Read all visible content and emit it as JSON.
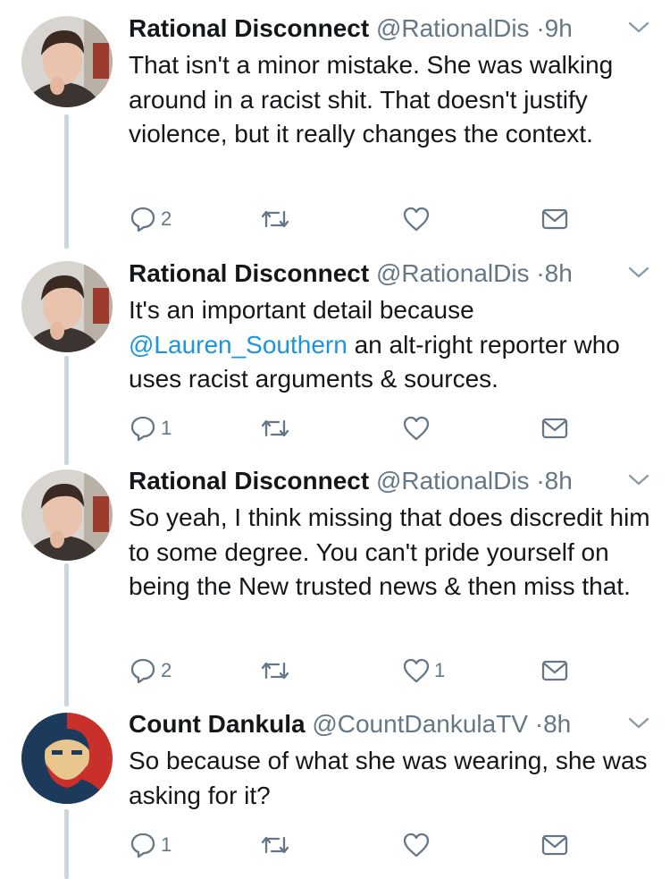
{
  "tweets": [
    {
      "name": "Rational Disconnect",
      "handle": "@RationalDis",
      "sep": "·",
      "time": "9h",
      "text_parts": [
        {
          "t": "That isn't a minor mistake. She was walking around in a racist shit. That doesn't justify violence, but it really changes the context."
        }
      ],
      "replies": "2",
      "retweets": "",
      "likes": ""
    },
    {
      "name": "Rational Disconnect",
      "handle": "@RationalDis",
      "sep": "·",
      "time": "8h",
      "text_parts": [
        {
          "t": "It's an important detail because "
        },
        {
          "t": "@Lauren_Southern",
          "mention": true
        },
        {
          "t": " an alt-right reporter who uses racist arguments & sources."
        }
      ],
      "replies": "1",
      "retweets": "",
      "likes": ""
    },
    {
      "name": "Rational Disconnect",
      "handle": "@RationalDis",
      "sep": "·",
      "time": "8h",
      "text_parts": [
        {
          "t": "So yeah, I think missing that does discredit him to some degree. You can't pride yourself on being the New trusted news & then miss that."
        }
      ],
      "replies": "2",
      "retweets": "",
      "likes": "1"
    },
    {
      "name": "Count Dankula",
      "handle": "@CountDankulaTV",
      "sep": "·",
      "time": "8h",
      "text_parts": [
        {
          "t": "So because of what she was wearing, she was asking for it?"
        }
      ],
      "replies": "1",
      "retweets": "",
      "likes": ""
    }
  ],
  "colors": {
    "text": "#14171a",
    "secondary": "#657786",
    "mention": "#1b95e0",
    "thread_line": "#ccd6dd"
  },
  "icons": [
    "reply-icon",
    "retweet-icon",
    "like-icon",
    "direct-message-icon",
    "caret-down-icon"
  ]
}
